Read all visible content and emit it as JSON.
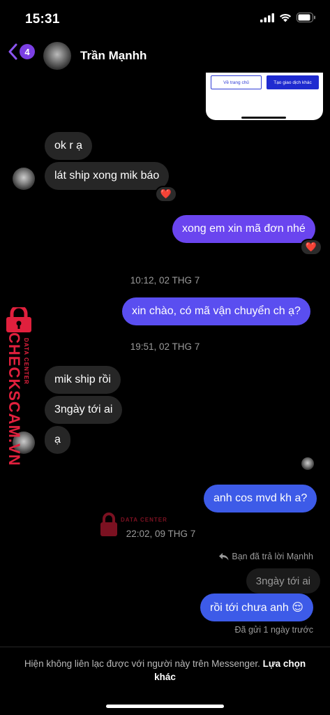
{
  "status_bar": {
    "time": "15:31"
  },
  "header": {
    "back_badge_count": "4",
    "contact_name": "Trần Mạnhh"
  },
  "shared_image": {
    "button_home": "Về trang chủ",
    "button_new_tx": "Tạo giao dịch khác"
  },
  "messages": {
    "m1": "ok r ạ",
    "m2": "lát ship xong mik báo",
    "m3": "xong em xin mã đơn nhé",
    "ts1": "10:12, 02 THG 7",
    "m4": "xin chào, có mã vận chuyển ch ạ?",
    "ts2": "19:51, 02 THG 7",
    "m5": "mik ship rồi",
    "m6": "3ngày tới ai",
    "m7": "ạ",
    "m8": "anh cos mvd kh a?",
    "ts3": "22:02, 09 THG 7",
    "reply_note": "Bạn đã trả lời Mạnhh",
    "quoted": "3ngày tới ai",
    "m9": "rồi tới chưa anh 😌",
    "sent_status": "Đã gửi 1 ngày trước"
  },
  "reactions": {
    "heart": "❤️"
  },
  "watermark": {
    "brand": "CHECKSCAM.VN",
    "sub": "DATA CENTER"
  },
  "footer": {
    "notice": "Hiện không liên lạc được với người này trên Messenger.",
    "link": "Lựa chọn khác"
  },
  "colors": {
    "outgoing_purple": "#6a45ef",
    "outgoing_blue": "#3d5be8",
    "incoming": "#262626",
    "badge": "#7b3fe4",
    "watermark": "#e0203d"
  }
}
